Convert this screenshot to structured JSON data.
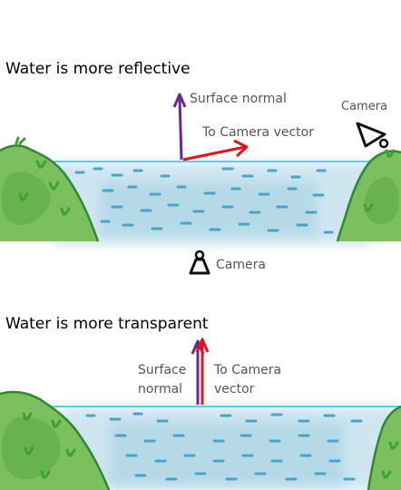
{
  "panel_top": {
    "title": "Water is more reflective",
    "surface_normal_label": "Surface normal",
    "to_camera_label": "To Camera vector",
    "camera_label": "Camera"
  },
  "camera_middle_label": "Camera",
  "panel_bottom": {
    "title": "Water is more transparent",
    "surface_label_line1": "Surface",
    "surface_label_line2": "normal",
    "to_camera_line1": "To Camera",
    "to_camera_line2": "vector"
  },
  "colors": {
    "water_line": "#4fd3ea",
    "water_fill": "#c9e4ee",
    "water_dash": "#4aa6cc",
    "grass": "#79b95a",
    "grass_dark": "#3e9a2e",
    "normal_arrow": "#6a2a92",
    "camera_arrow": "#e11515"
  }
}
